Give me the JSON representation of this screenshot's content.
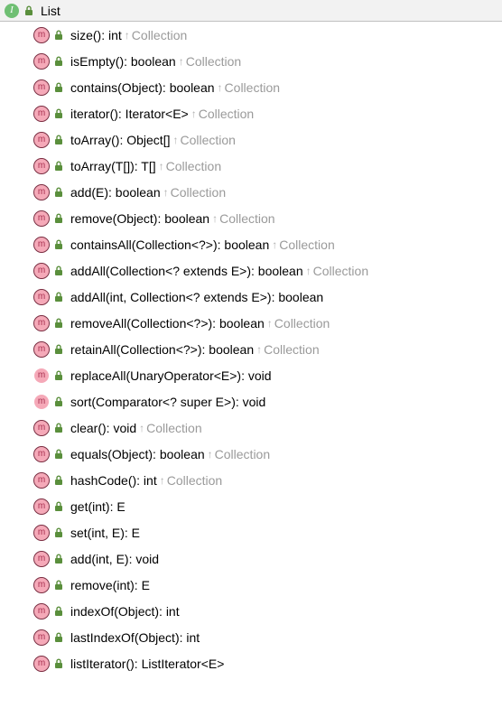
{
  "header": {
    "icon_letter": "I",
    "title": "List"
  },
  "methods": [
    {
      "icon_letter": "m",
      "abstract": true,
      "signature": "size(): int",
      "inherited_from": "Collection"
    },
    {
      "icon_letter": "m",
      "abstract": true,
      "signature": "isEmpty(): boolean",
      "inherited_from": "Collection"
    },
    {
      "icon_letter": "m",
      "abstract": true,
      "signature": "contains(Object): boolean",
      "inherited_from": "Collection"
    },
    {
      "icon_letter": "m",
      "abstract": true,
      "signature": "iterator(): Iterator<E>",
      "inherited_from": "Collection"
    },
    {
      "icon_letter": "m",
      "abstract": true,
      "signature": "toArray(): Object[]",
      "inherited_from": "Collection"
    },
    {
      "icon_letter": "m",
      "abstract": true,
      "signature": "toArray(T[]): T[]",
      "inherited_from": "Collection"
    },
    {
      "icon_letter": "m",
      "abstract": true,
      "signature": "add(E): boolean",
      "inherited_from": "Collection"
    },
    {
      "icon_letter": "m",
      "abstract": true,
      "signature": "remove(Object): boolean",
      "inherited_from": "Collection"
    },
    {
      "icon_letter": "m",
      "abstract": true,
      "signature": "containsAll(Collection<?>): boolean",
      "inherited_from": "Collection"
    },
    {
      "icon_letter": "m",
      "abstract": true,
      "signature": "addAll(Collection<? extends E>): boolean",
      "inherited_from": "Collection"
    },
    {
      "icon_letter": "m",
      "abstract": true,
      "signature": "addAll(int, Collection<? extends E>): boolean",
      "inherited_from": null
    },
    {
      "icon_letter": "m",
      "abstract": true,
      "signature": "removeAll(Collection<?>): boolean",
      "inherited_from": "Collection"
    },
    {
      "icon_letter": "m",
      "abstract": true,
      "signature": "retainAll(Collection<?>): boolean",
      "inherited_from": "Collection"
    },
    {
      "icon_letter": "m",
      "abstract": false,
      "signature": "replaceAll(UnaryOperator<E>): void",
      "inherited_from": null
    },
    {
      "icon_letter": "m",
      "abstract": false,
      "signature": "sort(Comparator<? super E>): void",
      "inherited_from": null
    },
    {
      "icon_letter": "m",
      "abstract": true,
      "signature": "clear(): void",
      "inherited_from": "Collection"
    },
    {
      "icon_letter": "m",
      "abstract": true,
      "signature": "equals(Object): boolean",
      "inherited_from": "Collection"
    },
    {
      "icon_letter": "m",
      "abstract": true,
      "signature": "hashCode(): int",
      "inherited_from": "Collection"
    },
    {
      "icon_letter": "m",
      "abstract": true,
      "signature": "get(int): E",
      "inherited_from": null
    },
    {
      "icon_letter": "m",
      "abstract": true,
      "signature": "set(int, E): E",
      "inherited_from": null
    },
    {
      "icon_letter": "m",
      "abstract": true,
      "signature": "add(int, E): void",
      "inherited_from": null
    },
    {
      "icon_letter": "m",
      "abstract": true,
      "signature": "remove(int): E",
      "inherited_from": null
    },
    {
      "icon_letter": "m",
      "abstract": true,
      "signature": "indexOf(Object): int",
      "inherited_from": null
    },
    {
      "icon_letter": "m",
      "abstract": true,
      "signature": "lastIndexOf(Object): int",
      "inherited_from": null
    },
    {
      "icon_letter": "m",
      "abstract": true,
      "signature": "listIterator(): ListIterator<E>",
      "inherited_from": null
    }
  ]
}
